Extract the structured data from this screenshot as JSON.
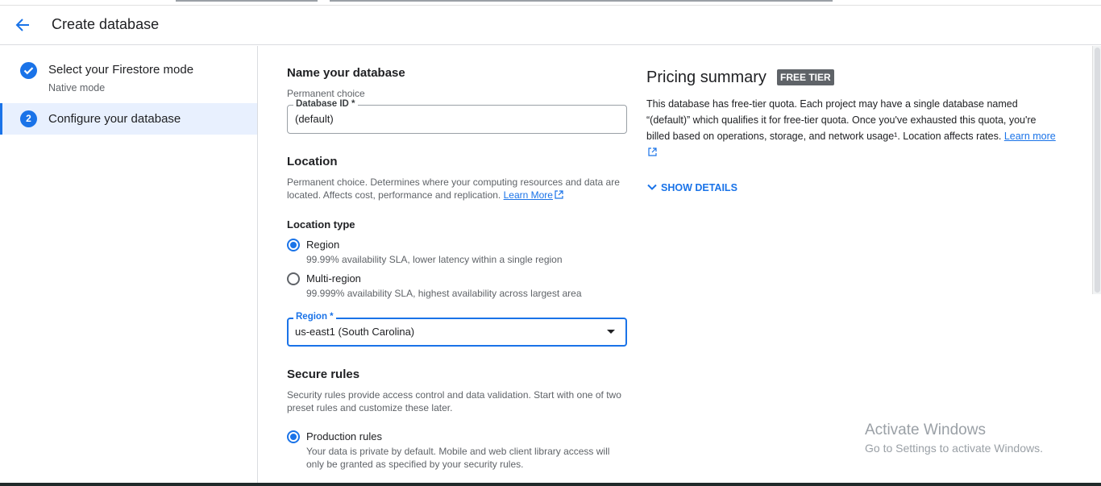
{
  "header": {
    "title": "Create database"
  },
  "sidebar": {
    "steps": [
      {
        "number": "",
        "title": "Select your Firestore mode",
        "subtitle": "Native mode"
      },
      {
        "number": "2",
        "title": "Configure your database"
      }
    ]
  },
  "name_section": {
    "heading": "Name your database",
    "permanent": "Permanent choice",
    "db_id_label": "Database ID *",
    "db_id_value": "(default)"
  },
  "location_section": {
    "heading": "Location",
    "desc": "Permanent choice. Determines where your computing resources and data are located. Affects cost, performance and replication.",
    "learn_more": "Learn More",
    "type_label": "Location type",
    "options": [
      {
        "label": "Region",
        "desc": "99.99% availability SLA, lower latency within a single region",
        "selected": true
      },
      {
        "label": "Multi-region",
        "desc": "99.999% availability SLA, highest availability across largest area",
        "selected": false
      }
    ],
    "region_label": "Region *",
    "region_value": "us-east1 (South Carolina)"
  },
  "rules_section": {
    "heading": "Secure rules",
    "desc": "Security rules provide access control and data validation. Start with one of two preset rules and customize these later.",
    "options": [
      {
        "label": "Production rules",
        "desc": "Your data is private by default. Mobile and web client library access will only be granted as specified by your security rules.",
        "selected": true
      }
    ]
  },
  "pricing": {
    "title": "Pricing summary",
    "badge": "FREE TIER",
    "desc": "This database has free-tier quota. Each project may have a single database named “(default)” which qualifies it for free-tier quota. Once you've exhausted this quota, you're billed based on operations, storage, and network usage¹. Location affects rates.",
    "learn_more": "Learn more",
    "show_details": "SHOW DETAILS"
  },
  "watermark": {
    "line1": "Activate Windows",
    "line2": "Go to Settings to activate Windows."
  },
  "colors": {
    "accent": "#1a73e8",
    "badge_bg": "#5f6368",
    "selected_step_bg": "#e8f0fe"
  }
}
